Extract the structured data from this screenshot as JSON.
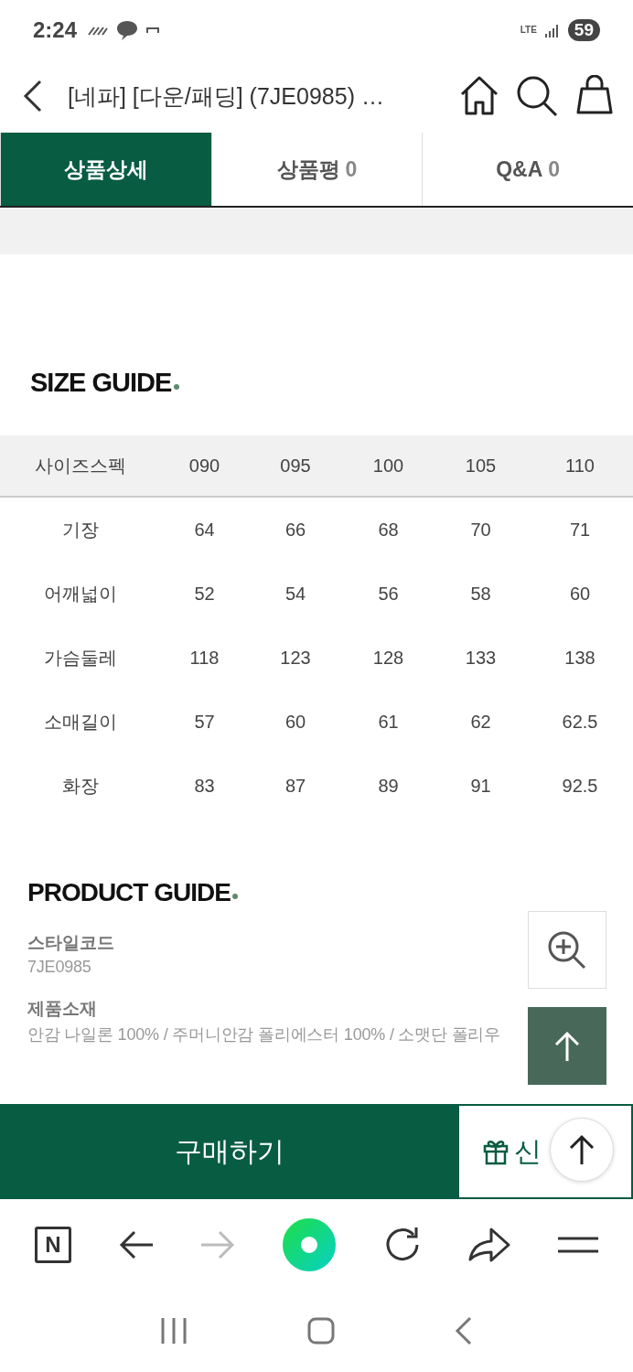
{
  "status_bar": {
    "time": "2:24",
    "network": "LTE",
    "battery": "59"
  },
  "header": {
    "title": "[네파] [다운/패딩] (7JE0985) …"
  },
  "tabs": [
    {
      "label": "상품상세",
      "selected": true
    },
    {
      "label": "상품평",
      "count": "0",
      "selected": false
    },
    {
      "label": "Q&A",
      "count": "0",
      "selected": false
    }
  ],
  "size_guide": {
    "title": "SIZE GUIDE",
    "columns": [
      "사이즈스펙",
      "090",
      "095",
      "100",
      "105",
      "110"
    ],
    "rows": [
      [
        "기장",
        "64",
        "66",
        "68",
        "70",
        "71"
      ],
      [
        "어깨넓이",
        "52",
        "54",
        "56",
        "58",
        "60"
      ],
      [
        "가슴둘레",
        "118",
        "123",
        "128",
        "133",
        "138"
      ],
      [
        "소매길이",
        "57",
        "60",
        "61",
        "62",
        "62.5"
      ],
      [
        "화장",
        "83",
        "87",
        "89",
        "91",
        "92.5"
      ]
    ]
  },
  "product_guide": {
    "title": "PRODUCT GUIDE",
    "items": [
      {
        "label": "스타일코드",
        "value": "7JE0985"
      },
      {
        "label": "제품소재",
        "value": "안감 나일론 100% / 주머니안감 폴리에스터 100% / 소맷단 폴리우"
      }
    ]
  },
  "buy_bar": {
    "buy": "구매하기",
    "gift": "신"
  },
  "browser_toolbar": [
    {
      "kind": "logo",
      "label": "N",
      "disabled": false
    },
    {
      "kind": "back",
      "disabled": false
    },
    {
      "kind": "forward",
      "disabled": true
    },
    {
      "kind": "green",
      "disabled": false
    },
    {
      "kind": "reload",
      "disabled": false
    },
    {
      "kind": "share",
      "disabled": false
    },
    {
      "kind": "menu",
      "disabled": false
    }
  ]
}
